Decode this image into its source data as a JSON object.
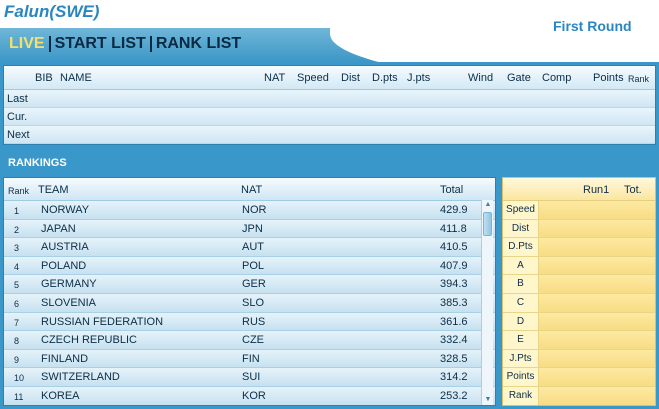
{
  "header": {
    "venue": "Falun(SWE)",
    "round": "First Round"
  },
  "nav": {
    "tabs": [
      {
        "label": "LIVE",
        "active": true
      },
      {
        "label": "START LIST",
        "active": false
      },
      {
        "label": "RANK LIST",
        "active": false
      }
    ]
  },
  "live": {
    "columns": {
      "bib": "BIB",
      "name": "NAME",
      "nat": "NAT",
      "speed": "Speed",
      "dist": "Dist",
      "dpts": "D.pts",
      "jpts": "J.pts",
      "wind": "Wind",
      "gate": "Gate",
      "comp": "Comp",
      "points": "Points",
      "rank": "Rank"
    },
    "rows": [
      "Last",
      "Cur.",
      "Next"
    ]
  },
  "rankings": {
    "title": "RANKINGS",
    "columns": {
      "rank": "Rank",
      "team": "TEAM",
      "nat": "NAT",
      "total": "Total"
    },
    "rows": [
      {
        "rank": "1",
        "team": "NORWAY",
        "nat": "NOR",
        "total": "429.9"
      },
      {
        "rank": "2",
        "team": "JAPAN",
        "nat": "JPN",
        "total": "411.8"
      },
      {
        "rank": "3",
        "team": "AUSTRIA",
        "nat": "AUT",
        "total": "410.5"
      },
      {
        "rank": "4",
        "team": "POLAND",
        "nat": "POL",
        "total": "407.9"
      },
      {
        "rank": "5",
        "team": "GERMANY",
        "nat": "GER",
        "total": "394.3"
      },
      {
        "rank": "6",
        "team": "SLOVENIA",
        "nat": "SLO",
        "total": "385.3"
      },
      {
        "rank": "7",
        "team": "RUSSIAN FEDERATION",
        "nat": "RUS",
        "total": "361.6"
      },
      {
        "rank": "8",
        "team": "CZECH REPUBLIC",
        "nat": "CZE",
        "total": "332.4"
      },
      {
        "rank": "9",
        "team": "FINLAND",
        "nat": "FIN",
        "total": "328.5"
      },
      {
        "rank": "10",
        "team": "SWITZERLAND",
        "nat": "SUI",
        "total": "314.2"
      },
      {
        "rank": "11",
        "team": "KOREA",
        "nat": "KOR",
        "total": "253.2"
      }
    ]
  },
  "detail": {
    "columns": {
      "run1": "Run1",
      "tot": "Tot."
    },
    "rows": [
      "Speed",
      "Dist",
      "D.Pts",
      "A",
      "B",
      "C",
      "D",
      "E",
      "J.Pts",
      "Points",
      "Rank"
    ]
  },
  "colors": {
    "accent": "#2b86c0",
    "active_tab": "#f4e06b",
    "panel_bg": "#3a97c9",
    "detail_bg": "#fbe9a5"
  },
  "icons": {
    "scroll_up": "▲",
    "scroll_down": "▼"
  }
}
